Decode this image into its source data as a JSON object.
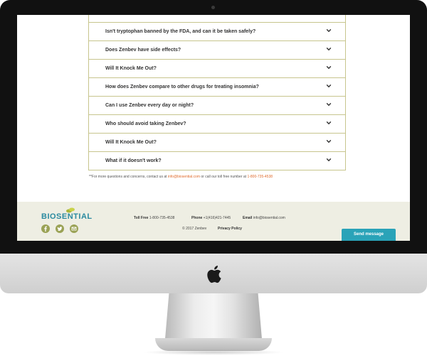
{
  "faq": {
    "items": [
      {
        "question": "Isn't tryptophan banned by the FDA, and can it be taken safely?"
      },
      {
        "question": "Does Zenbev have side effects?"
      },
      {
        "question": "Will It Knock Me Out?"
      },
      {
        "question": "How does Zenbev compare to other drugs for treating insomnia?"
      },
      {
        "question": "Can I use Zenbev every day or night?"
      },
      {
        "question": "Who should avoid taking Zenbev?"
      },
      {
        "question": "Will It Knock Me Out?"
      },
      {
        "question": "What if it doesn't work?"
      }
    ],
    "note_prefix": "**For more questions and concerns, contact us at ",
    "note_email": "info@biosential.com",
    "note_middle": " or call our toll free number at ",
    "note_phone": "1-800-735-4538"
  },
  "footer": {
    "logo_text": "BIOSENTIAL",
    "toll_free_label": "Toll Free",
    "toll_free_value": "1-800-735-4538",
    "phone_label": "Phone",
    "phone_value": "+1(416)421-7445",
    "email_label": "Email",
    "email_value": "info@biosential.com",
    "copyright": "© 2017 Zenbev",
    "privacy_label": "Privacy Policy",
    "send_label": "Send message"
  },
  "colors": {
    "accent": "#2aa3b8",
    "border": "#c7c58d",
    "link": "#e06b2d",
    "footer_bg": "#eeeee3",
    "social": "#9aa255"
  }
}
